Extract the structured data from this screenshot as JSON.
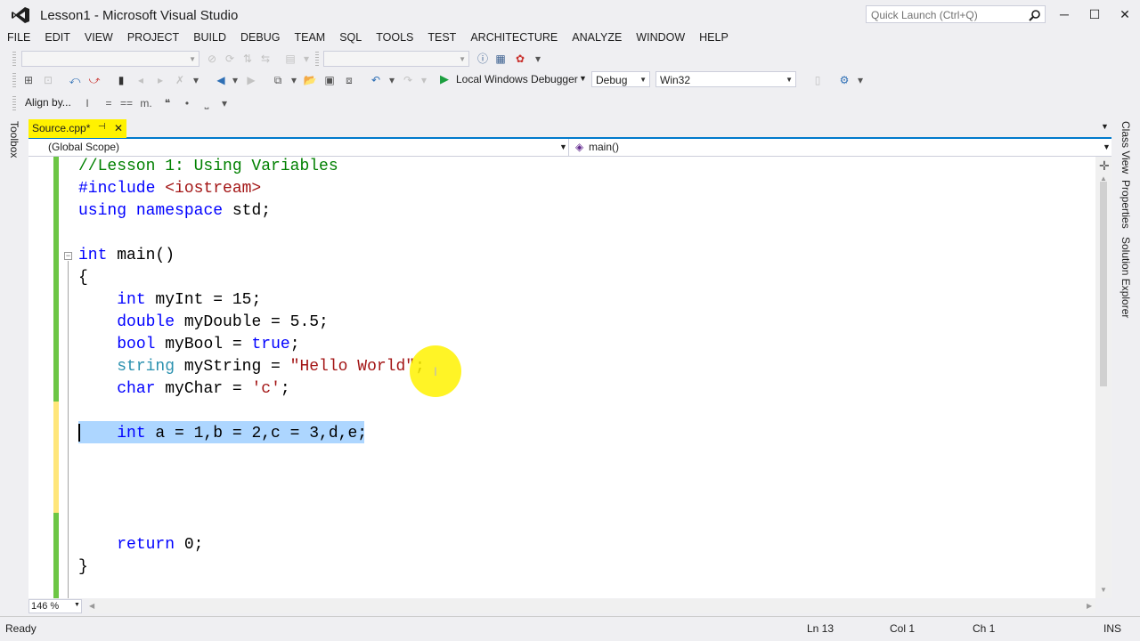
{
  "window": {
    "title": "Lesson1 - Microsoft Visual Studio",
    "quick_launch_placeholder": "Quick Launch (Ctrl+Q)",
    "controls": [
      "─",
      "☐",
      "✕"
    ]
  },
  "menu": [
    "FILE",
    "EDIT",
    "VIEW",
    "PROJECT",
    "BUILD",
    "DEBUG",
    "TEAM",
    "SQL",
    "TOOLS",
    "TEST",
    "ARCHITECTURE",
    "ANALYZE",
    "WINDOW",
    "HELP"
  ],
  "toolbar": {
    "debugger_label": "Local Windows Debugger",
    "configuration": "Debug",
    "platform": "Win32",
    "align_label": "Align by..."
  },
  "tabs": [
    {
      "label": "Source.cpp*",
      "pin": "⊣",
      "close": "✕",
      "active": true
    }
  ],
  "navbar": {
    "scope": "(Global Scope)",
    "member": "main()"
  },
  "code": {
    "lines": [
      [
        {
          "t": "//Lesson 1: Using Variables",
          "c": "cmt"
        }
      ],
      [
        {
          "t": "#include ",
          "c": "kw"
        },
        {
          "t": "<iostream>",
          "c": "inc"
        }
      ],
      [
        {
          "t": "using",
          "c": "kw"
        },
        {
          "t": " "
        },
        {
          "t": "namespace",
          "c": "kw"
        },
        {
          "t": " std;"
        }
      ],
      [],
      [
        {
          "t": "int",
          "c": "kw"
        },
        {
          "t": " main()"
        }
      ],
      [
        {
          "t": "{"
        }
      ],
      [
        {
          "t": "    "
        },
        {
          "t": "int",
          "c": "kw"
        },
        {
          "t": " myInt = 15;"
        }
      ],
      [
        {
          "t": "    "
        },
        {
          "t": "double",
          "c": "kw"
        },
        {
          "t": " myDouble = 5.5;"
        }
      ],
      [
        {
          "t": "    "
        },
        {
          "t": "bool",
          "c": "kw"
        },
        {
          "t": " myBool = "
        },
        {
          "t": "true",
          "c": "kw"
        },
        {
          "t": ";"
        }
      ],
      [
        {
          "t": "    "
        },
        {
          "t": "string",
          "c": "typ"
        },
        {
          "t": " myString = "
        },
        {
          "t": "\"Hello World\"",
          "c": "str"
        },
        {
          "t": ";"
        }
      ],
      [
        {
          "t": "    "
        },
        {
          "t": "char",
          "c": "kw"
        },
        {
          "t": " myChar = "
        },
        {
          "t": "'c'",
          "c": "str"
        },
        {
          "t": ";"
        }
      ],
      [],
      [
        {
          "t": "    "
        },
        {
          "t": "int",
          "c": "kw"
        },
        {
          "t": " a = 1,b = 2,c = 3,d,e;"
        }
      ],
      [],
      [],
      [],
      [],
      [
        {
          "t": "    "
        },
        {
          "t": "return",
          "c": "kw"
        },
        {
          "t": " 0;"
        }
      ],
      [
        {
          "t": "}"
        }
      ]
    ]
  },
  "zoom": "146 %",
  "side_tabs": {
    "left": [
      "Toolbox"
    ],
    "right": [
      "Class View",
      "Properties",
      "Solution Explorer"
    ]
  },
  "status": {
    "state": "Ready",
    "line": "Ln 13",
    "col": "Col 1",
    "ch": "Ch 1",
    "mode": "INS"
  },
  "colors": {
    "accent": "#007acc",
    "active_tab": "#fff200",
    "selection": "#add6ff",
    "keyword": "#0000ff",
    "comment": "#008000",
    "string": "#a31515",
    "type": "#2b91af"
  }
}
